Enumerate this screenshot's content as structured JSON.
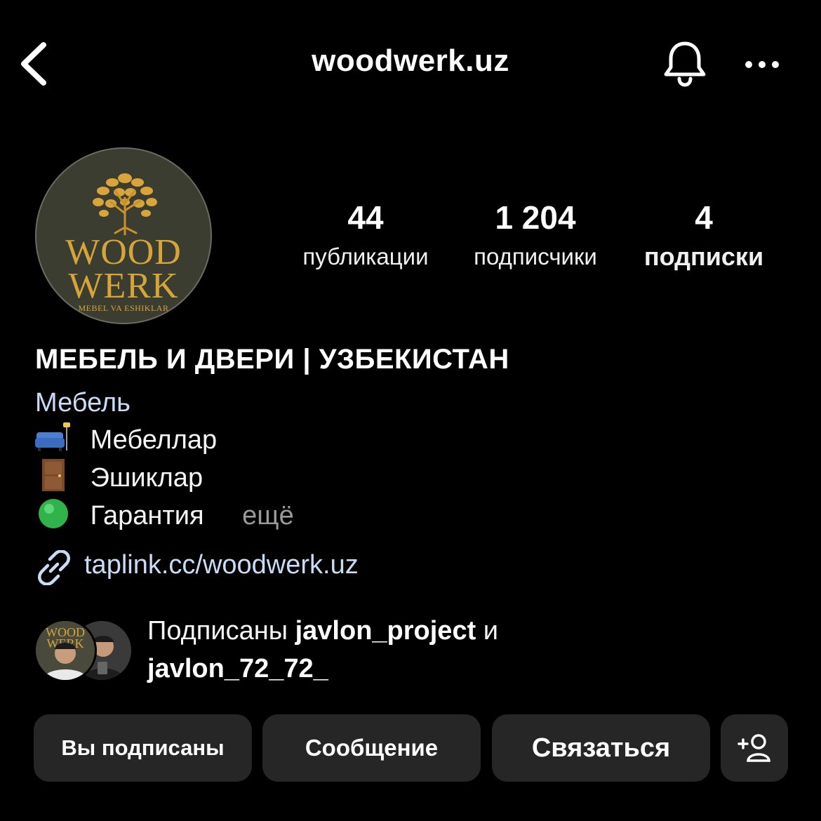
{
  "header": {
    "username": "woodwerk.uz",
    "icons": [
      "chevron-left-icon",
      "bell-icon",
      "more-horizontal-icon"
    ]
  },
  "avatar": {
    "logo_line1": "WOOD",
    "logo_line2": "WERK",
    "logo_sub": "MEBEL VA ESHIKLAR"
  },
  "stats": {
    "posts": {
      "value": "44",
      "label": "публикации"
    },
    "followers": {
      "value": "1 204",
      "label": "подписчики"
    },
    "following": {
      "value": "4",
      "label": "подписки"
    }
  },
  "bio": {
    "name": "МЕБЕЛЬ И ДВЕРИ | УЗБЕКИСТАН",
    "category": "Мебель",
    "lines": [
      {
        "icon": "couch-icon",
        "text": "Мебеллар"
      },
      {
        "icon": "door-icon",
        "text": "Эшиклар"
      },
      {
        "icon": "green-circle-icon",
        "text": "Гарантия"
      }
    ],
    "more": "ещё",
    "link": "taplink.cc/woodwerk.uz"
  },
  "mutual": {
    "prefix": "Подписаны",
    "user1": "javlon_project",
    "conj": "и",
    "user2": "javlon_72_72_"
  },
  "buttons": {
    "following": "Вы подписаны",
    "message": "Сообщение",
    "contact": "Связаться"
  },
  "colors": {
    "background": "#000000",
    "button_bg": "#262626",
    "link": "#c9dcf5",
    "logo_gold": "#d6a53a",
    "muted": "#9a9a9a"
  }
}
